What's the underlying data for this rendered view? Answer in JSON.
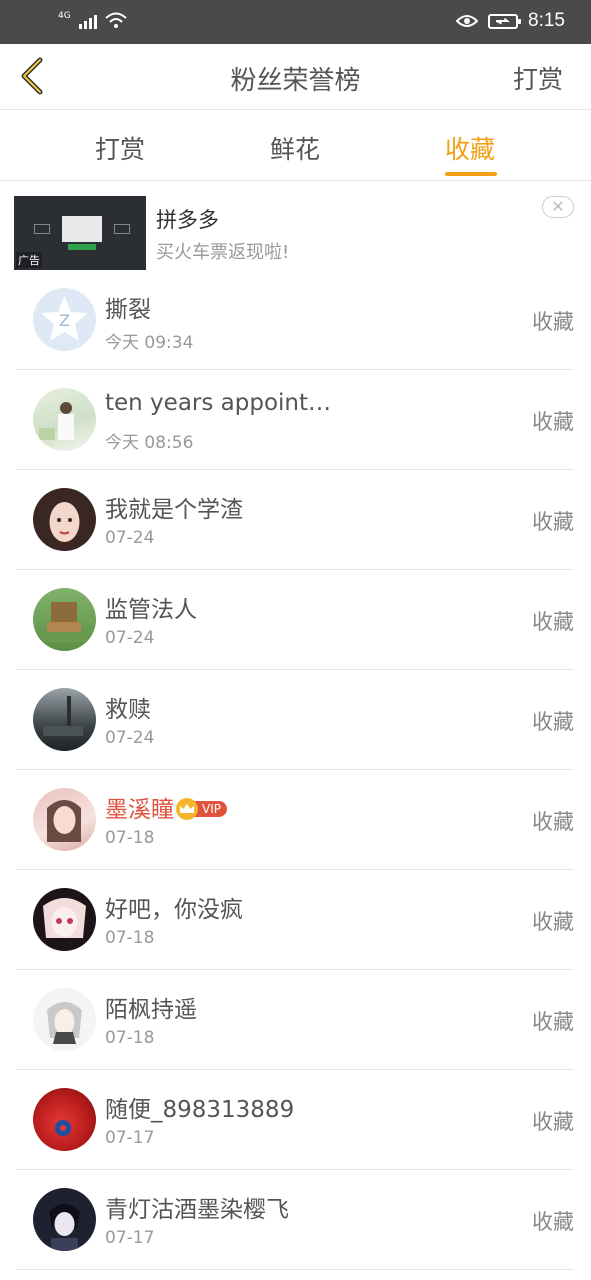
{
  "status_bar": {
    "network": "4G",
    "time": "8:15",
    "icons": [
      "signal-icon",
      "wifi-icon",
      "eye-icon",
      "battery-charging-icon"
    ]
  },
  "header": {
    "back_icon": "chevron-left-icon",
    "title": "粉丝荣誉榜",
    "right_action": "打赏"
  },
  "tabs": [
    {
      "label": "打赏",
      "active": false
    },
    {
      "label": "鲜花",
      "active": false
    },
    {
      "label": "收藏",
      "active": true
    }
  ],
  "ad": {
    "title": "拼多多",
    "subtitle": "买火车票返现啦!",
    "tag": "广告",
    "close_icon": "close-icon"
  },
  "colors": {
    "accent": "#f1a018",
    "vip": "#e0533c",
    "status_bar": "#4a4a4a",
    "divider": "#e6e6e6"
  },
  "fans": [
    {
      "name": "撕裂",
      "time": "今天 09:34",
      "action": "收藏"
    },
    {
      "name": "ten years appoint…",
      "time": "今天 08:56",
      "action": "收藏"
    },
    {
      "name": "我就是个学渣",
      "time": "07-24",
      "action": "收藏"
    },
    {
      "name": "监管法人",
      "time": "07-24",
      "action": "收藏"
    },
    {
      "name": "救赎",
      "time": "07-24",
      "action": "收藏"
    },
    {
      "name": "墨溪瞳",
      "time": "07-18",
      "action": "收藏",
      "vip": "VIP"
    },
    {
      "name": "好吧，你没疯",
      "time": "07-18",
      "action": "收藏"
    },
    {
      "name": "陌枫持遥",
      "time": "07-18",
      "action": "收藏"
    },
    {
      "name": "随便_898313889",
      "time": "07-17",
      "action": "收藏"
    },
    {
      "name": "青灯沽酒墨染樱飞",
      "time": "07-17",
      "action": "收藏"
    }
  ]
}
